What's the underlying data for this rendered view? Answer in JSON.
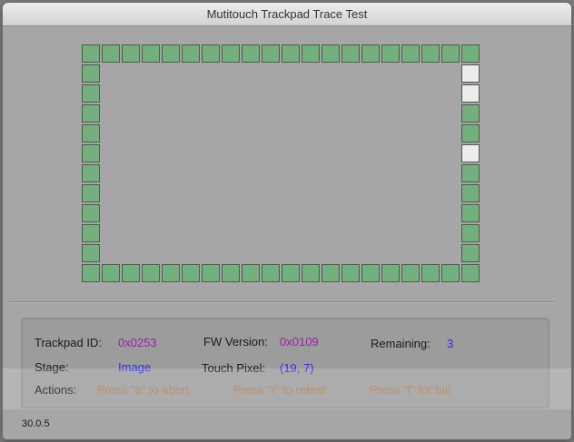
{
  "window": {
    "title": "Mutitouch Trackpad Trace Test"
  },
  "grid": {
    "columns": 20,
    "rows": 12,
    "pending_cells": [
      [
        19,
        1
      ],
      [
        19,
        2
      ],
      [
        19,
        5
      ]
    ],
    "colors": {
      "done": "#74b07e",
      "pending": "#ececec"
    }
  },
  "info": {
    "trackpad_id_label": "Trackpad ID:",
    "trackpad_id_value": "0x0253",
    "fw_version_label": "FW Version:",
    "fw_version_value": "0x0109",
    "remaining_label": "Remaining:",
    "remaining_value": "3",
    "stage_label": "Stage:",
    "stage_value": "Image",
    "touch_pixel_label": "Touch Pixel:",
    "touch_pixel_value": "(19, 7)",
    "actions_label": "Actions:",
    "action_abort": "Press \"a\" to abort",
    "action_retest": "Press \"r\" to retest",
    "action_fail": "Press \"f\" for fail"
  },
  "footer": {
    "version": "30.0.5"
  },
  "colors": {
    "id_value": "#9a1fa6",
    "status_value": "#2a2af2",
    "action_text": "#b07a4c"
  }
}
